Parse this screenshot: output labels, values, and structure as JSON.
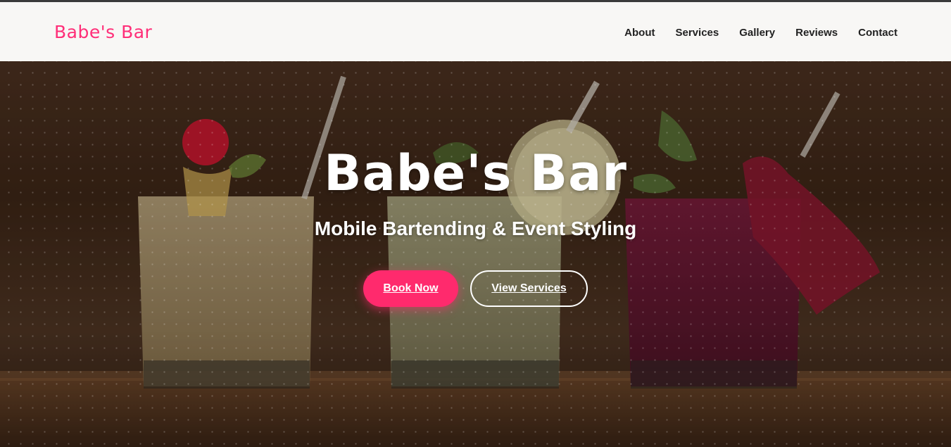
{
  "brand": {
    "name": "Babe's Bar",
    "color": "#ff2e78"
  },
  "nav": {
    "items": [
      {
        "label": "About"
      },
      {
        "label": "Services"
      },
      {
        "label": "Gallery"
      },
      {
        "label": "Reviews"
      },
      {
        "label": "Contact"
      }
    ]
  },
  "hero": {
    "title": "Babe's Bar",
    "subtitle": "Mobile Bartending & Event Styling",
    "primary_button": "Book Now",
    "secondary_button": "View Services",
    "accent_color": "#ff2a6d",
    "background_description_icon": "cocktail-glasses-photo"
  }
}
